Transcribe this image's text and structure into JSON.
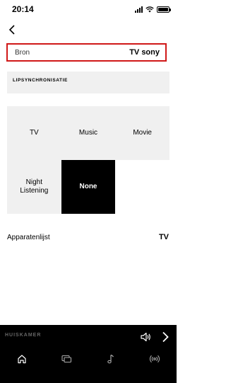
{
  "status": {
    "time": "20:14"
  },
  "source": {
    "label": "Bron",
    "value": "TV sony"
  },
  "lipsync": {
    "label": "LIPSYNCHRONISATIE"
  },
  "modes": {
    "tv": "TV",
    "music": "Music",
    "movie": "Movie",
    "night_line1": "Night",
    "night_line2": "Listening",
    "none": "None",
    "selected": "None"
  },
  "device_list": {
    "label": "Apparatenlijst",
    "value": "TV"
  },
  "now_playing": {
    "room": "HUISKAMER"
  },
  "tabs": [
    "home-icon",
    "devices-icon",
    "music-note-icon",
    "radio-waves-icon"
  ],
  "colors": {
    "highlight_border": "#d01818",
    "panel_bg": "#f0f0f0",
    "selected_bg": "#000000"
  }
}
